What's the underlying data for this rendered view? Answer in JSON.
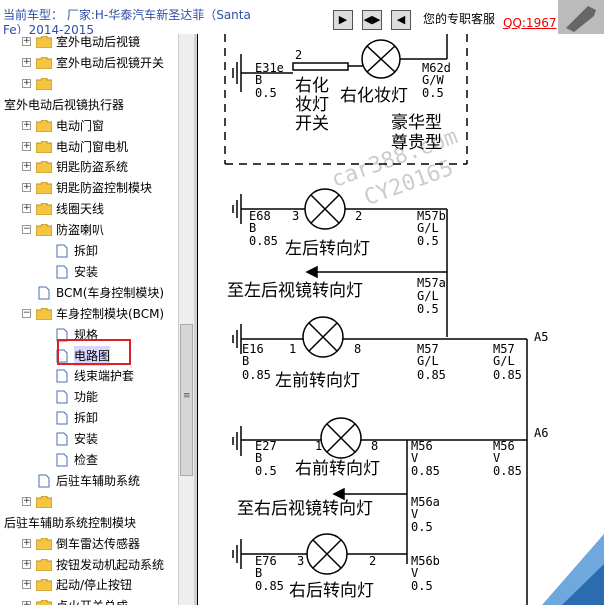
{
  "header": {
    "title": "当前车型： 厂家:H-华泰汽车新圣达菲（Santa Fe）2014-2015",
    "nav_buttons": [
      "▶",
      "◀▶",
      "◀"
    ],
    "support_label": "您的专职客服",
    "qq_link": "QQ:1967"
  },
  "tree": {
    "items": [
      {
        "label": "室外电动后视镜",
        "type": "folder"
      },
      {
        "label": "室外电动后视镜开关",
        "type": "folder"
      },
      {
        "label": "",
        "type": "folder"
      },
      {
        "label": "室外电动后视镜执行器",
        "type": "text"
      },
      {
        "label": "电动门窗",
        "type": "folder"
      },
      {
        "label": "电动门窗电机",
        "type": "folder"
      },
      {
        "label": "钥匙防盗系统",
        "type": "folder"
      },
      {
        "label": "钥匙防盗控制模块",
        "type": "folder"
      },
      {
        "label": "线圈天线",
        "type": "folder"
      },
      {
        "label": "防盗喇叭",
        "type": "folder-open"
      },
      {
        "label": "拆卸",
        "type": "doc"
      },
      {
        "label": "安装",
        "type": "doc"
      },
      {
        "label": "BCM(车身控制模块)",
        "type": "doc"
      },
      {
        "label": "车身控制模块(BCM)",
        "type": "folder-open"
      },
      {
        "label": "规格",
        "type": "doc"
      },
      {
        "label": "电路图",
        "type": "doc"
      },
      {
        "label": "线束端护套",
        "type": "doc"
      },
      {
        "label": "功能",
        "type": "doc"
      },
      {
        "label": "拆卸",
        "type": "doc"
      },
      {
        "label": "安装",
        "type": "doc"
      },
      {
        "label": "检查",
        "type": "doc"
      },
      {
        "label": "后驻车辅助系统",
        "type": "doc"
      },
      {
        "label": "",
        "type": "folder"
      },
      {
        "label": "后驻车辅助系统控制模块",
        "type": "text"
      },
      {
        "label": "倒车雷达传感器",
        "type": "folder"
      },
      {
        "label": "按钮发动机起动系统",
        "type": "folder"
      },
      {
        "label": "起动/停止按钮",
        "type": "folder"
      },
      {
        "label": "点火开关总成",
        "type": "folder"
      }
    ]
  },
  "diagram": {
    "top_box": {
      "left_label": "E31e",
      "left_color": "B",
      "left_size": "0.5",
      "pin_left": "2",
      "lamp_label": "右化妆灯",
      "switch_label": "右化\n妆灯\n开关",
      "right_label": "M62d",
      "right_color": "G/W",
      "right_size": "0.5",
      "variant": "豪华型\n尊贵型"
    },
    "rl_turn": {
      "ground": "E68",
      "gcolor": "B",
      "gsize": "0.85",
      "pin1": "3",
      "pin2": "2",
      "conn": "M57b",
      "color": "G/L",
      "size": "0.5",
      "label": "左后转向灯"
    },
    "left_mirror": {
      "label": "至左后视镜转向灯",
      "conn": "M57a",
      "color": "G/L",
      "size": "0.5"
    },
    "lf_turn": {
      "ground": "E16",
      "gcolor": "B",
      "gsize": "0.85",
      "pin1": "1",
      "pin2": "8",
      "conn": "M57",
      "color": "G/L",
      "size": "0.85",
      "conn2": "M57",
      "color2": "G/L",
      "size2": "0.85",
      "label": "左前转向灯",
      "terminal": "A5"
    },
    "rf_turn": {
      "ground": "E27",
      "gcolor": "B",
      "gsize": "0.5",
      "pin1": "1",
      "pin2": "8",
      "conn": "M56",
      "color": "V",
      "size": "0.85",
      "conn2": "M56",
      "color2": "V",
      "size2": "0.85",
      "label": "右前转向灯",
      "terminal": "A6"
    },
    "right_mirror": {
      "label": "至右后视镜转向灯",
      "conn": "M56a",
      "color": "V",
      "size": "0.5"
    },
    "rr_turn": {
      "ground": "E76",
      "gcolor": "B",
      "gsize": "0.85",
      "pin1": "3",
      "pin2": "2",
      "conn": "M56b",
      "color": "V",
      "size": "0.5",
      "label": "右后转向灯"
    },
    "watermark": "car388.com\nCY20165"
  }
}
